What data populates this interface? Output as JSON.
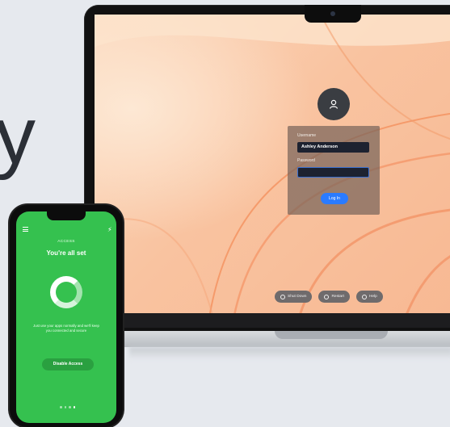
{
  "background_letter": "y",
  "laptop": {
    "login": {
      "username_label": "Username",
      "username_value": "Ashley Anderson",
      "password_label": "Password",
      "password_value": "",
      "login_button": "Log In"
    },
    "footer_buttons": [
      {
        "label": "Shut Down",
        "icon": "power-icon"
      },
      {
        "label": "Restart",
        "icon": "restart-icon"
      },
      {
        "label": "Help",
        "icon": "help-icon"
      }
    ]
  },
  "phone": {
    "header": "ACCESS",
    "title": "You're all set",
    "description": "Just use your apps normally and we'll keep you connected and secure",
    "disable_button": "Disable Access",
    "page_dots": {
      "count": 4,
      "active": 3
    },
    "colors": {
      "screen": "#35c14f",
      "button": "#2aa040"
    }
  },
  "colors": {
    "login_button": "#2a7bff",
    "wallpaper": "#f9c3a0"
  }
}
